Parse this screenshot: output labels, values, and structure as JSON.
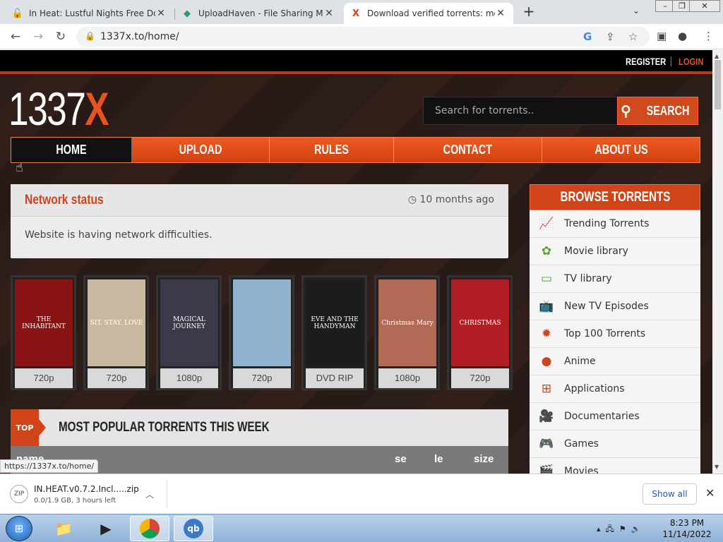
{
  "browser": {
    "tabs": [
      {
        "title": "In Heat: Lustful Nights Free Dow"
      },
      {
        "title": "UploadHaven - File Sharing Mad"
      },
      {
        "title": "Download verified torrents: movi"
      }
    ],
    "new_tab": "+",
    "url": "1337x.to/home/",
    "status_link": "https://1337x.to/home/"
  },
  "site": {
    "register": "REGISTER",
    "separator": "|",
    "login": "LOGIN",
    "logo_main": "1337",
    "logo_x": "X",
    "search_placeholder": "Search for torrents..",
    "search_button": "SEARCH",
    "nav": [
      "HOME",
      "UPLOAD",
      "RULES",
      "CONTACT",
      "ABOUT US"
    ],
    "network": {
      "title": "Network status",
      "time": "10 months ago",
      "message": "Website is having network difficulties."
    },
    "posters": [
      {
        "caption": "THE INHABITANT",
        "quality": "720p",
        "color": "#8a1414"
      },
      {
        "caption": "SIT. STAY. LOVE",
        "quality": "720p",
        "color": "#c8b8a0"
      },
      {
        "caption": "MAGICAL JOURNEY",
        "quality": "1080p",
        "color": "#3b3a4a"
      },
      {
        "caption": "",
        "quality": "720p",
        "color": "#8fb2cf"
      },
      {
        "caption": "EVE AND THE HANDYMAN",
        "quality": "DVD RIP",
        "color": "#1c1c1c"
      },
      {
        "caption": "Christmas Mary",
        "quality": "1080p",
        "color": "#b06a55"
      },
      {
        "caption": "CHRISTMAS",
        "quality": "720p",
        "color": "#b01e24"
      }
    ],
    "popular": {
      "badge": "TOP",
      "title": "MOST POPULAR TORRENTS THIS WEEK",
      "columns": [
        "name",
        "se",
        "le",
        "size"
      ]
    },
    "browse": {
      "title": "BROWSE TORRENTS",
      "items": [
        {
          "label": "Trending Torrents",
          "icon": "trending-icon"
        },
        {
          "label": "Movie library",
          "icon": "film-reel-icon"
        },
        {
          "label": "TV library",
          "icon": "tv-library-icon"
        },
        {
          "label": "New TV Episodes",
          "icon": "tv-icon"
        },
        {
          "label": "Top 100 Torrents",
          "icon": "top100-icon"
        },
        {
          "label": "Anime",
          "icon": "anime-icon"
        },
        {
          "label": "Applications",
          "icon": "windows-icon"
        },
        {
          "label": "Documentaries",
          "icon": "camera-icon"
        },
        {
          "label": "Games",
          "icon": "gamepad-icon"
        },
        {
          "label": "Movies",
          "icon": "clapper-icon"
        }
      ]
    }
  },
  "downloads": {
    "filename": "IN.HEAT.v0.7.2.Incl.....zip",
    "status": "0.0/1.9 GB, 3 hours left",
    "show_all": "Show all"
  },
  "taskbar": {
    "time": "8:23 PM",
    "date": "11/14/2022"
  }
}
